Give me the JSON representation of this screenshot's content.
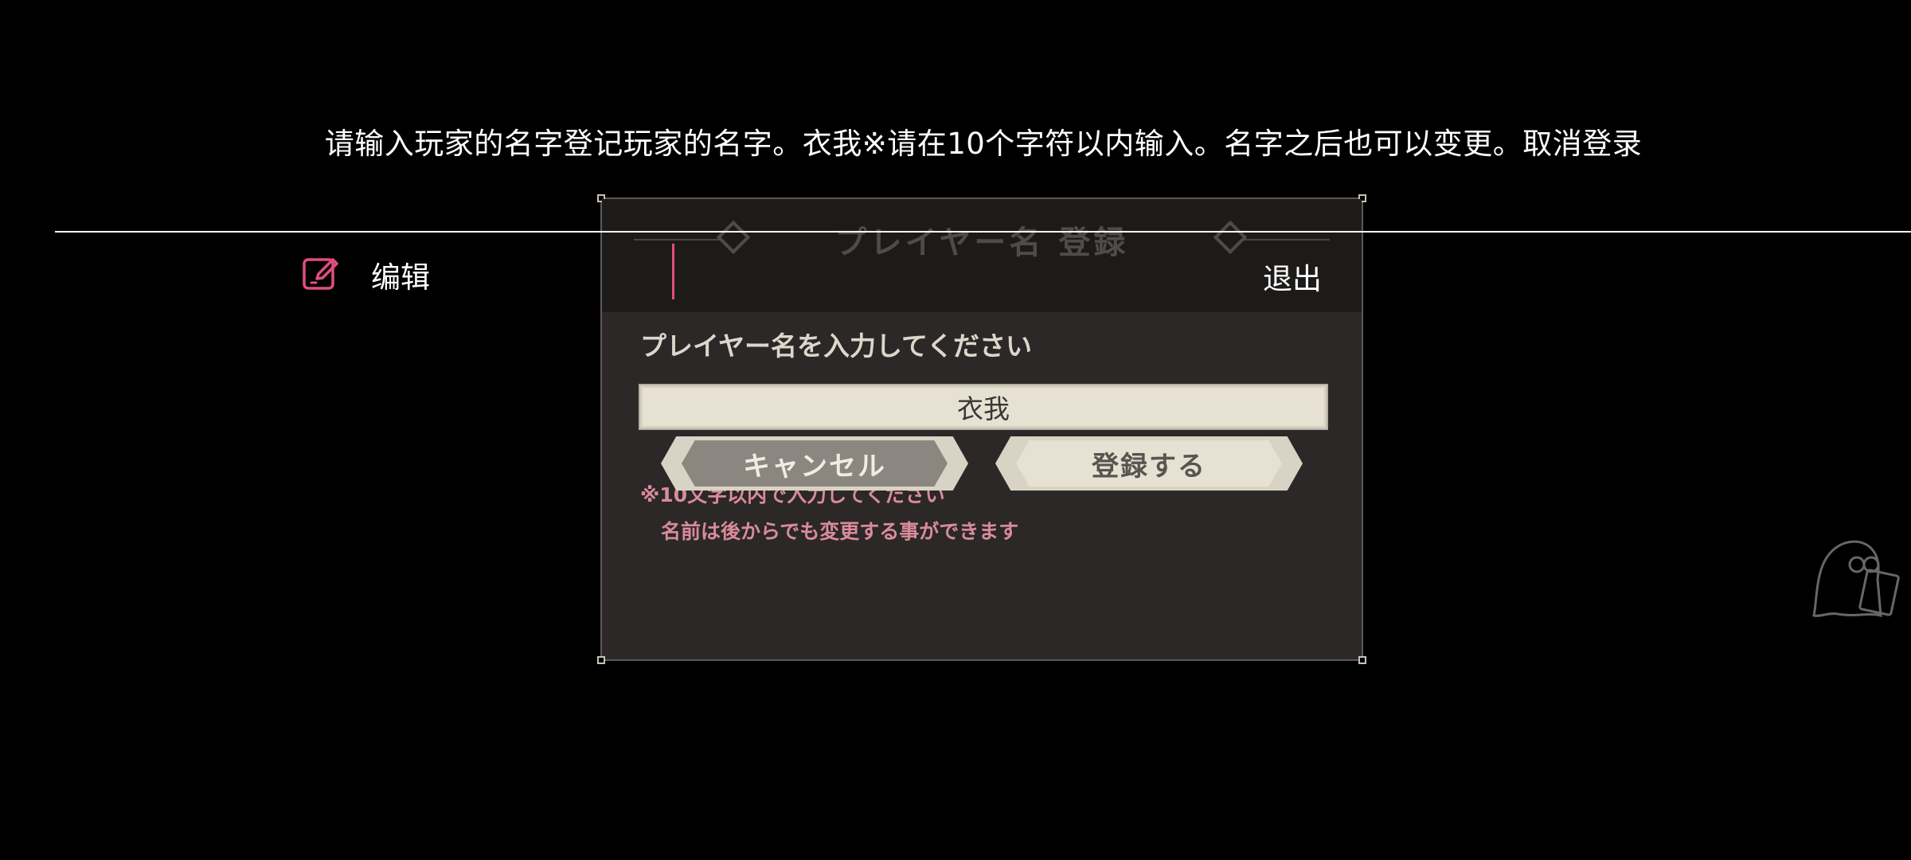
{
  "caption": {
    "text": "请输入玩家的名字登记玩家的名字。衣我※请在10个字符以内输入。名字之后也可以变更。取消登录"
  },
  "dialog": {
    "title": "プレイヤー名 登録",
    "prompt": "プレイヤー名を入力してください",
    "name_value": "衣我",
    "note_line1": "※10文字以内で入力してください",
    "note_line2": "名前は後からでも変更する事ができます",
    "cancel_label": "キャンセル",
    "register_label": "登録する"
  },
  "overlay": {
    "edit_label": "编辑",
    "exit_label": "退出"
  },
  "icons": {
    "edit": "edit-icon",
    "ghost": "ghost-mascot-icon",
    "diamond": "diamond-ornament-icon"
  },
  "colors": {
    "background": "#000000",
    "dialog_bg": "#2b2827",
    "accent_pink": "#e04e7c",
    "note_pink": "#d98b9b",
    "input_bg": "#e6e1d3"
  }
}
